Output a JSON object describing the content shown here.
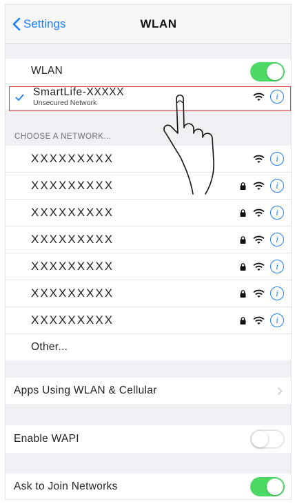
{
  "navbar": {
    "back_label": "Settings",
    "title": "WLAN"
  },
  "wlan_toggle": {
    "label": "WLAN",
    "state": "on"
  },
  "connected": {
    "name": "SmartLife-XXXXX",
    "subtitle": "Unsecured Network"
  },
  "section_header": "CHOOSE A NETWORK...",
  "networks": [
    {
      "name": "XXXXXXXXX",
      "locked": false
    },
    {
      "name": "XXXXXXXXX",
      "locked": true
    },
    {
      "name": "XXXXXXXXX",
      "locked": true
    },
    {
      "name": "XXXXXXXXX",
      "locked": true
    },
    {
      "name": "XXXXXXXXX",
      "locked": true
    },
    {
      "name": "XXXXXXXXX",
      "locked": true
    },
    {
      "name": "XXXXXXXXX",
      "locked": true
    }
  ],
  "other_label": "Other...",
  "apps_row": {
    "label": "Apps Using WLAN & Cellular"
  },
  "wapi_row": {
    "label": "Enable WAPI",
    "state": "off"
  },
  "ask_row": {
    "label": "Ask to Join Networks",
    "state": "on"
  },
  "colors": {
    "accent": "#1a7cf5",
    "toggle_on": "#4cd964",
    "highlight": "#e03c3c"
  }
}
